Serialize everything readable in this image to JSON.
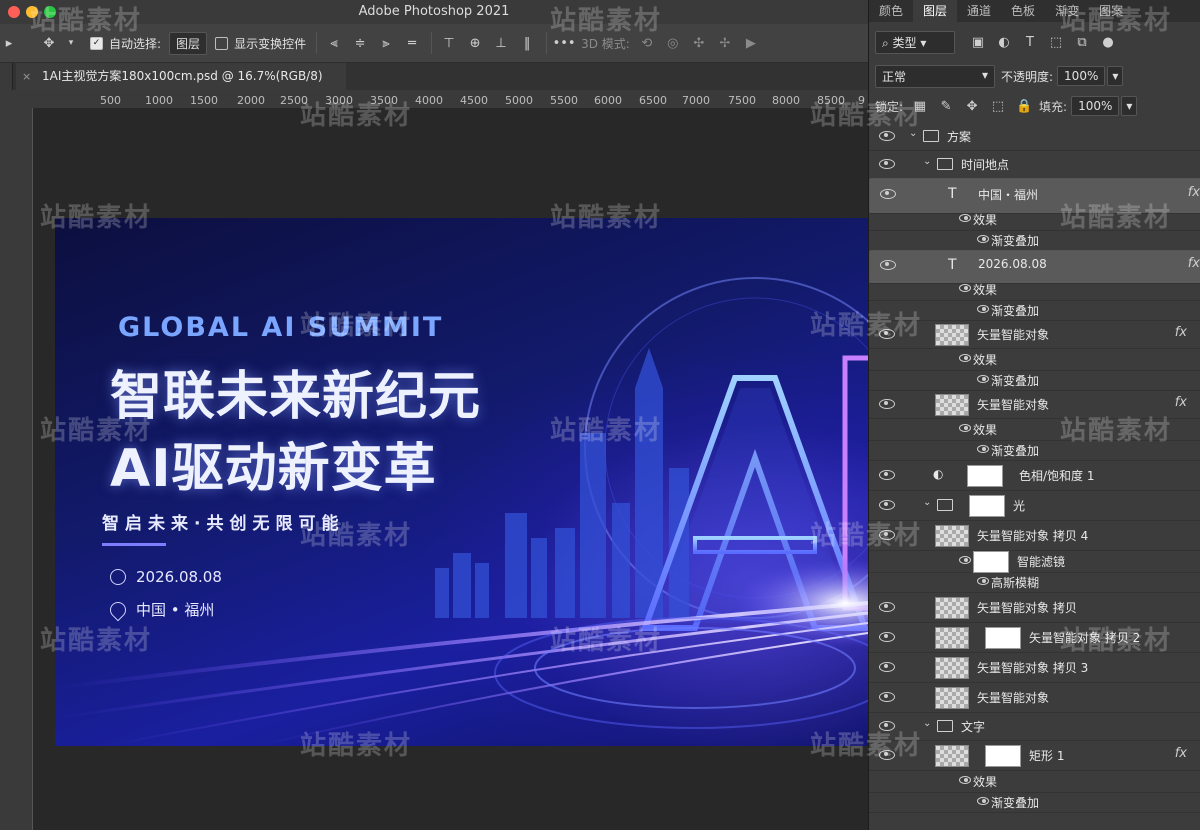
{
  "window": {
    "app_title": "Adobe Photoshop 2021"
  },
  "options_bar": {
    "auto_select_label": "自动选择:",
    "auto_select_value": "图层",
    "show_transform_label": "显示变换控件",
    "mode_3d_label": "3D 模式:"
  },
  "document": {
    "tab_title": "1AI主视觉方案180x100cm.psd @ 16.7%(RGB/8)"
  },
  "ruler": {
    "ticks": [
      "500",
      "1000",
      "1500",
      "2000",
      "2500",
      "3000",
      "3500",
      "4000",
      "4500",
      "5000",
      "5500",
      "6000",
      "6500",
      "7000",
      "7500",
      "8000",
      "8500",
      "9"
    ]
  },
  "artwork": {
    "title_en": "GLOBAL AI SUMMIT",
    "headline_1": "智联未来新纪元",
    "headline_2": "AI驱动新变革",
    "subtitle": "智启未来·共创无限可能",
    "date": "2026.08.08",
    "location": "中国 • 福州",
    "big_letters": "AI"
  },
  "watermark_text": "站酷素材",
  "panel": {
    "tabs": [
      "颜色",
      "图层",
      "通道",
      "色板",
      "渐变",
      "图案"
    ],
    "active_tab": "图层",
    "filter_label": "类型",
    "blend_mode": "正常",
    "opacity_label": "不透明度:",
    "opacity_value": "100%",
    "lock_label": "锁定:",
    "fill_label": "填充:",
    "fill_value": "100%",
    "layers": [
      {
        "name": "方案",
        "kind": "group"
      },
      {
        "name": "时间地点",
        "kind": "group"
      },
      {
        "name": "中国・福州",
        "kind": "text",
        "fx": "fx"
      },
      {
        "name": "效果",
        "kind": "effects"
      },
      {
        "name": "渐变叠加",
        "kind": "effect"
      },
      {
        "name": "2026.08.08",
        "kind": "text",
        "fx": "fx"
      },
      {
        "name": "效果",
        "kind": "effects"
      },
      {
        "name": "渐变叠加",
        "kind": "effect"
      },
      {
        "name": "矢量智能对象",
        "kind": "smart",
        "fx": "fx"
      },
      {
        "name": "效果",
        "kind": "effects"
      },
      {
        "name": "渐变叠加",
        "kind": "effect"
      },
      {
        "name": "矢量智能对象",
        "kind": "smart",
        "fx": "fx"
      },
      {
        "name": "效果",
        "kind": "effects"
      },
      {
        "name": "渐变叠加",
        "kind": "effect"
      },
      {
        "name": "色相/饱和度 1",
        "kind": "adjustment"
      },
      {
        "name": "光",
        "kind": "group"
      },
      {
        "name": "矢量智能对象 拷贝 4",
        "kind": "smart"
      },
      {
        "name": "智能滤镜",
        "kind": "filters"
      },
      {
        "name": "高斯模糊",
        "kind": "filter"
      },
      {
        "name": "矢量智能对象 拷贝",
        "kind": "smart"
      },
      {
        "name": "矢量智能对象 拷贝 2",
        "kind": "smart"
      },
      {
        "name": "矢量智能对象 拷贝 3",
        "kind": "smart"
      },
      {
        "name": "矢量智能对象",
        "kind": "smart"
      },
      {
        "name": "文字",
        "kind": "group"
      },
      {
        "name": "矩形 1",
        "kind": "shape",
        "fx": "fx"
      },
      {
        "name": "效果",
        "kind": "effects"
      },
      {
        "name": "渐变叠加",
        "kind": "effect"
      }
    ]
  },
  "colors": {
    "accent_blue": "#7aa6ff",
    "panel_bg": "#3c3c3c",
    "canvas_bg": "#282828",
    "art_bg": "#121a6b"
  }
}
